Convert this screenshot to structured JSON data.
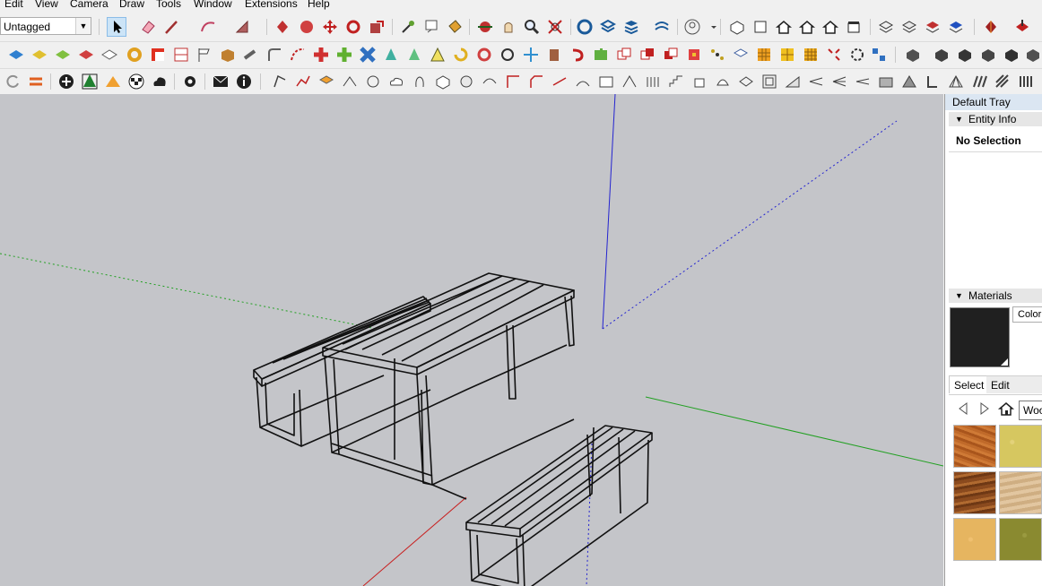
{
  "menu": [
    "Edit",
    "View",
    "Camera",
    "Draw",
    "Tools",
    "Window",
    "Extensions",
    "Help"
  ],
  "toolbar": {
    "tag_selector": {
      "value": "Untagged"
    }
  },
  "tray": {
    "title": "Default Tray",
    "entity_info": {
      "header": "Entity Info",
      "status": "No Selection"
    },
    "materials": {
      "header": "Materials",
      "color_button": "Color",
      "tabs": [
        "Select",
        "Edit"
      ],
      "library": "Woo",
      "current_color": "#202020",
      "thumbnails": [
        "wood-dark-orange",
        "wood-light-yellow",
        "wood-plank-brown",
        "wood-plank-light",
        "wood-cork",
        "wood-olive"
      ]
    }
  },
  "colors": {
    "viewport_bg": "#c4c5c9",
    "axis_blue": "#2424d0",
    "axis_red": "#c82020",
    "axis_green": "#22a022",
    "accent": "#cce4f7"
  }
}
